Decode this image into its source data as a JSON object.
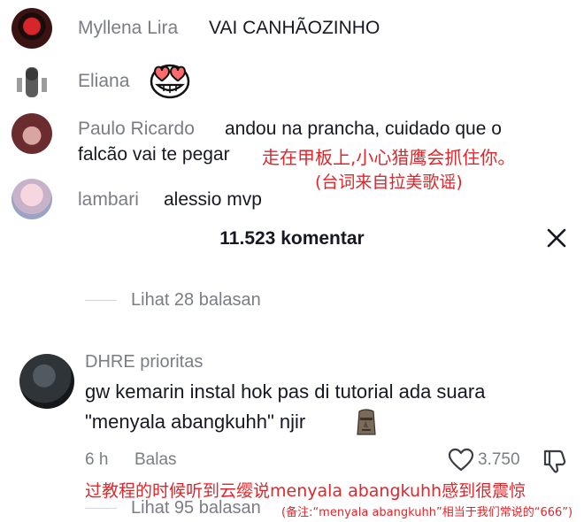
{
  "comments_top": [
    {
      "name": "Myllena Lira",
      "text": "VAI CANHÃOZINHO"
    },
    {
      "name": "Eliana",
      "text": ""
    },
    {
      "name": "Paulo Ricardo",
      "text_line1": "andou na prancha, cuidado que o",
      "text_line2": "falcão vai te pegar"
    },
    {
      "name": "lambari",
      "text": "alessio mvp"
    }
  ],
  "annotation_paulo_line1": "走在甲板上,小心猎鹰会抓住你。",
  "annotation_paulo_line2": "(台词来自拉美歌谣)",
  "header": {
    "title": "11.523 komentar"
  },
  "replies_1": "Lihat 28 balasan",
  "main_comment": {
    "name": "DHRE prioritas",
    "text_line1": "gw kemarin instal hok pas di tutorial ada suara",
    "text_line2": "\"menyala abangkuhh\" njir",
    "time": "6 h",
    "reply_label": "Balas",
    "likes": "3.750"
  },
  "annotation_main": "过教程的时候听到云缨说menyala abangkuhh感到很震惊",
  "replies_2": "Lihat 95 balasan",
  "annotation_note": "(备注:“menyala abangkuhh”相当于我们常说的“666”)",
  "icons": [
    "heart-eyes-icon",
    "moai-icon",
    "close-icon",
    "heart-icon",
    "dislike-icon"
  ],
  "colors": {
    "annotation": "#e0262b",
    "muted": "#7a7d86",
    "text": "#161823"
  }
}
